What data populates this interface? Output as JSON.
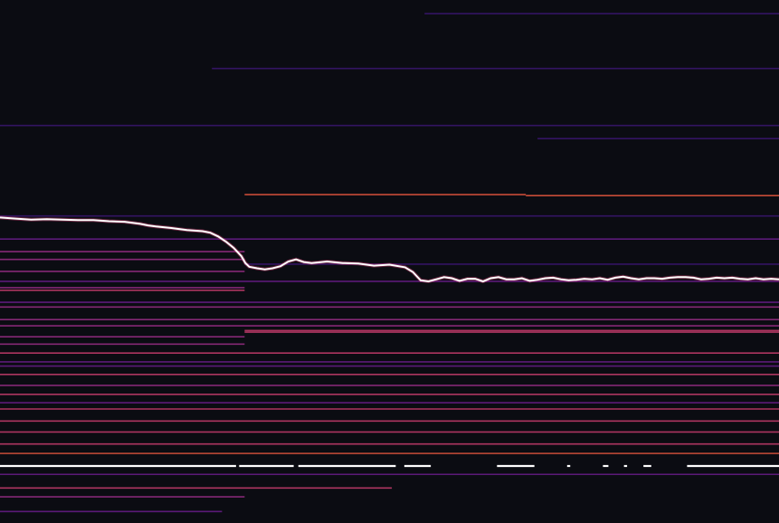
{
  "chart_data": {
    "type": "heatmap",
    "title": "",
    "xlabel": "",
    "ylabel": "",
    "grid": false,
    "legend": "none",
    "x_range": [
      0,
      100
    ],
    "y_range": [
      0,
      100
    ],
    "colormap": [
      "#1c1040",
      "#3a1670",
      "#6a1d8a",
      "#9a2d86",
      "#c93d6e",
      "#e9573f",
      "#f68d2e",
      "#ffffff"
    ],
    "bands": [
      {
        "y": 2.6,
        "x0": 54.5,
        "x1": 100,
        "intensity": 0.1
      },
      {
        "y": 13.1,
        "x0": 27.2,
        "x1": 100,
        "intensity": 0.15
      },
      {
        "y": 24.0,
        "x0": 0,
        "x1": 100,
        "intensity": 0.12
      },
      {
        "y": 26.5,
        "x0": 69.0,
        "x1": 100,
        "intensity": 0.1
      },
      {
        "y": 37.2,
        "x0": 31.4,
        "x1": 67.5,
        "intensity": 0.72
      },
      {
        "y": 37.4,
        "x0": 67.5,
        "x1": 100,
        "intensity": 0.7
      },
      {
        "y": 41.3,
        "x0": 0,
        "x1": 100,
        "intensity": 0.2
      },
      {
        "y": 45.7,
        "x0": 0,
        "x1": 100,
        "intensity": 0.3
      },
      {
        "y": 48.1,
        "x0": 0,
        "x1": 31.4,
        "intensity": 0.38
      },
      {
        "y": 49.6,
        "x0": 0,
        "x1": 31.4,
        "intensity": 0.4
      },
      {
        "y": 50.5,
        "x0": 31.4,
        "x1": 100,
        "intensity": 0.2
      },
      {
        "y": 51.9,
        "x0": 0,
        "x1": 31.4,
        "intensity": 0.42
      },
      {
        "y": 53.8,
        "x0": 0,
        "x1": 100,
        "intensity": 0.25
      },
      {
        "y": 55.0,
        "x0": 0,
        "x1": 31.4,
        "intensity": 0.45
      },
      {
        "y": 55.5,
        "x0": 0,
        "x1": 31.4,
        "intensity": 0.5
      },
      {
        "y": 57.8,
        "x0": 0,
        "x1": 100,
        "intensity": 0.3
      },
      {
        "y": 58.7,
        "x0": 0,
        "x1": 100,
        "intensity": 0.4
      },
      {
        "y": 61.1,
        "x0": 0,
        "x1": 100,
        "intensity": 0.4
      },
      {
        "y": 62.3,
        "x0": 0,
        "x1": 100,
        "intensity": 0.45
      },
      {
        "y": 63.2,
        "x0": 31.4,
        "x1": 100,
        "intensity": 0.6
      },
      {
        "y": 63.5,
        "x0": 31.4,
        "x1": 100,
        "intensity": 0.55
      },
      {
        "y": 64.4,
        "x0": 0,
        "x1": 31.4,
        "intensity": 0.4
      },
      {
        "y": 65.8,
        "x0": 0,
        "x1": 31.4,
        "intensity": 0.38
      },
      {
        "y": 67.5,
        "x0": 0,
        "x1": 100,
        "intensity": 0.6
      },
      {
        "y": 69.2,
        "x0": 0,
        "x1": 100,
        "intensity": 0.3
      },
      {
        "y": 70.0,
        "x0": 0,
        "x1": 100,
        "intensity": 0.35
      },
      {
        "y": 71.6,
        "x0": 0,
        "x1": 100,
        "intensity": 0.5
      },
      {
        "y": 73.7,
        "x0": 0,
        "x1": 100,
        "intensity": 0.45
      },
      {
        "y": 75.4,
        "x0": 0,
        "x1": 100,
        "intensity": 0.55
      },
      {
        "y": 77.0,
        "x0": 0,
        "x1": 100,
        "intensity": 0.35
      },
      {
        "y": 78.2,
        "x0": 0,
        "x1": 100,
        "intensity": 0.6
      },
      {
        "y": 80.5,
        "x0": 0,
        "x1": 100,
        "intensity": 0.6
      },
      {
        "y": 82.6,
        "x0": 0,
        "x1": 100,
        "intensity": 0.6
      },
      {
        "y": 84.9,
        "x0": 0,
        "x1": 100,
        "intensity": 0.6
      },
      {
        "y": 86.7,
        "x0": 0,
        "x1": 100,
        "intensity": 0.65
      },
      {
        "y": 90.7,
        "x0": 0,
        "x1": 100,
        "intensity": 0.25
      },
      {
        "y": 93.3,
        "x0": 0,
        "x1": 50.3,
        "intensity": 0.55
      },
      {
        "y": 95.0,
        "x0": 0,
        "x1": 31.4,
        "intensity": 0.4
      },
      {
        "y": 97.8,
        "x0": 0,
        "x1": 28.5,
        "intensity": 0.3
      }
    ],
    "bright_segments": [
      {
        "y": 89.1,
        "x0": 0,
        "x1": 30.3
      },
      {
        "y": 89.1,
        "x0": 30.7,
        "x1": 37.7
      },
      {
        "y": 89.1,
        "x0": 38.3,
        "x1": 50.8
      },
      {
        "y": 89.1,
        "x0": 51.9,
        "x1": 55.3
      },
      {
        "y": 89.1,
        "x0": 63.8,
        "x1": 68.6
      },
      {
        "y": 89.1,
        "x0": 72.8,
        "x1": 73.2
      },
      {
        "y": 89.1,
        "x0": 77.4,
        "x1": 78.1
      },
      {
        "y": 89.1,
        "x0": 80.1,
        "x1": 80.5
      },
      {
        "y": 89.1,
        "x0": 82.6,
        "x1": 83.6
      },
      {
        "y": 89.1,
        "x0": 88.2,
        "x1": 100
      }
    ],
    "series": [
      {
        "x": [
          0,
          2,
          4,
          6,
          8,
          10,
          12,
          14,
          16,
          18,
          19,
          20,
          22,
          24,
          26,
          27,
          28,
          29,
          30,
          31,
          31.5,
          32,
          33,
          34,
          35,
          36,
          37,
          38,
          39,
          40,
          42,
          44,
          46,
          48,
          50,
          52,
          53,
          54,
          55,
          56,
          57,
          58,
          59,
          60,
          61,
          62,
          63,
          64,
          65,
          66,
          67,
          68,
          69,
          70,
          71,
          72,
          73,
          74,
          75,
          76,
          77,
          78,
          79,
          80,
          81,
          82,
          83,
          84,
          85,
          86,
          87,
          88,
          89,
          90,
          91,
          92,
          93,
          94,
          95,
          96,
          97,
          98,
          99,
          100
        ],
        "y": [
          41.6,
          41.8,
          42.0,
          41.9,
          42.0,
          42.1,
          42.1,
          42.3,
          42.4,
          42.8,
          43.1,
          43.3,
          43.6,
          44.0,
          44.2,
          44.5,
          45.2,
          46.2,
          47.4,
          49.0,
          50.3,
          51.0,
          51.3,
          51.5,
          51.3,
          50.9,
          50.0,
          49.6,
          50.1,
          50.3,
          50.0,
          50.3,
          50.4,
          50.8,
          50.6,
          51.1,
          52.0,
          53.6,
          53.8,
          53.4,
          53.0,
          53.2,
          53.7,
          53.3,
          53.3,
          53.8,
          53.2,
          53.0,
          53.4,
          53.4,
          53.2,
          53.7,
          53.5,
          53.2,
          53.1,
          53.4,
          53.6,
          53.5,
          53.3,
          53.4,
          53.2,
          53.5,
          53.1,
          52.9,
          53.2,
          53.4,
          53.2,
          53.2,
          53.3,
          53.1,
          53.0,
          53.0,
          53.1,
          53.4,
          53.3,
          53.1,
          53.2,
          53.1,
          53.3,
          53.4,
          53.2,
          53.4,
          53.3,
          53.4
        ]
      }
    ]
  }
}
